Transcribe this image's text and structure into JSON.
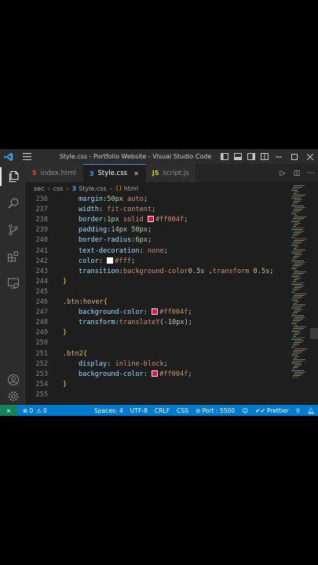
{
  "titlebar": {
    "title": "Style.css - Portfolio Website - Visual Studio Code",
    "menu_icon": "hamburger-icon",
    "logo_icon": "vscode-logo-icon"
  },
  "activitybar": [
    "explorer-icon",
    "search-icon",
    "source-control-icon",
    "extensions-icon",
    "remote-explorer-icon",
    "account-icon",
    "settings-gear-icon"
  ],
  "tabs": [
    {
      "label": "index.html",
      "icon": "5",
      "icon_color": "#e44d26",
      "active": false
    },
    {
      "label": "Style.css",
      "icon": "3",
      "icon_color": "#42a5f5",
      "active": true
    },
    {
      "label": "script.js",
      "icon": "JS",
      "icon_color": "#cbcb41",
      "active": false
    }
  ],
  "breadcrumb": {
    "parts": [
      "sec",
      "css",
      "Style.css",
      "html"
    ],
    "file_icon": "3",
    "selector_icon": "{}"
  },
  "code_lines": [
    {
      "n": "236",
      "indent": true,
      "segments": [
        [
          "prop",
          "margin"
        ],
        [
          "punc",
          ":"
        ],
        [
          "num",
          "50px"
        ],
        [
          "val",
          " auto"
        ],
        [
          "punc",
          ";"
        ]
      ]
    },
    {
      "n": "237",
      "indent": true,
      "segments": [
        [
          "prop",
          "width"
        ],
        [
          "punc",
          ": "
        ],
        [
          "val",
          "fit-content"
        ],
        [
          "punc",
          ";"
        ]
      ]
    },
    {
      "n": "238",
      "indent": true,
      "swatch": "#ff004f",
      "segments": [
        [
          "prop",
          "border"
        ],
        [
          "punc",
          ":"
        ],
        [
          "num",
          "1px"
        ],
        [
          "val",
          " solid "
        ],
        [
          "swatch",
          ""
        ],
        [
          "val",
          "#ff004f"
        ],
        [
          "punc",
          ";"
        ]
      ]
    },
    {
      "n": "239",
      "indent": true,
      "segments": [
        [
          "prop",
          "padding"
        ],
        [
          "punc",
          ":"
        ],
        [
          "num",
          "14px 50px"
        ],
        [
          "punc",
          ";"
        ]
      ]
    },
    {
      "n": "240",
      "indent": true,
      "segments": [
        [
          "prop",
          "border-radius"
        ],
        [
          "punc",
          ":"
        ],
        [
          "num",
          "6px"
        ],
        [
          "punc",
          ";"
        ]
      ]
    },
    {
      "n": "241",
      "indent": true,
      "segments": [
        [
          "prop",
          "text-decoration"
        ],
        [
          "punc",
          ": "
        ],
        [
          "val",
          "none"
        ],
        [
          "punc",
          ";"
        ]
      ]
    },
    {
      "n": "242",
      "indent": true,
      "swatch": "#ffffff",
      "segments": [
        [
          "prop",
          "color"
        ],
        [
          "punc",
          ": "
        ],
        [
          "swatch",
          ""
        ],
        [
          "val",
          "#fff"
        ],
        [
          "punc",
          ";"
        ]
      ]
    },
    {
      "n": "243",
      "indent": true,
      "segments": [
        [
          "prop",
          "transition"
        ],
        [
          "punc",
          ":"
        ],
        [
          "val",
          "background-color"
        ],
        [
          "num",
          "0.5s"
        ],
        [
          "punc",
          " ,"
        ],
        [
          "val",
          "transform "
        ],
        [
          "num",
          "0.5s"
        ],
        [
          "punc",
          ";"
        ]
      ]
    },
    {
      "n": "244",
      "indent": false,
      "segments": [
        [
          "brace",
          "}"
        ]
      ]
    },
    {
      "n": "245",
      "indent": false,
      "segments": []
    },
    {
      "n": "246",
      "indent": false,
      "segments": [
        [
          "sel",
          ".btn:hover"
        ],
        [
          "brace",
          "{"
        ]
      ]
    },
    {
      "n": "247",
      "indent": true,
      "swatch": "#ff004f",
      "segments": [
        [
          "prop",
          "background-color"
        ],
        [
          "punc",
          ": "
        ],
        [
          "swatch",
          ""
        ],
        [
          "val",
          "#ff004f"
        ],
        [
          "punc",
          ";"
        ]
      ]
    },
    {
      "n": "248",
      "indent": true,
      "segments": [
        [
          "prop",
          "transform"
        ],
        [
          "punc",
          ":"
        ],
        [
          "val",
          "translateY"
        ],
        [
          "punc",
          "("
        ],
        [
          "num",
          "-10px"
        ],
        [
          "punc",
          ");"
        ]
      ]
    },
    {
      "n": "249",
      "indent": false,
      "segments": [
        [
          "brace",
          "}"
        ]
      ]
    },
    {
      "n": "250",
      "indent": false,
      "segments": []
    },
    {
      "n": "251",
      "indent": false,
      "segments": [
        [
          "sel",
          ".btn2"
        ],
        [
          "brace",
          "{"
        ]
      ]
    },
    {
      "n": "252",
      "indent": true,
      "segments": [
        [
          "prop",
          "display"
        ],
        [
          "punc",
          ": "
        ],
        [
          "val",
          "inline-block"
        ],
        [
          "punc",
          ";"
        ]
      ]
    },
    {
      "n": "253",
      "indent": true,
      "swatch": "#ff004f",
      "segments": [
        [
          "prop",
          "background-color"
        ],
        [
          "punc",
          ": "
        ],
        [
          "swatch",
          ""
        ],
        [
          "val",
          "#ff004f"
        ],
        [
          "punc",
          ";"
        ]
      ]
    },
    {
      "n": "254",
      "indent": false,
      "segments": [
        [
          "brace",
          "}"
        ]
      ]
    },
    {
      "n": "255",
      "indent": false,
      "segments": []
    }
  ],
  "statusbar": {
    "errors": "0",
    "warnings": "0",
    "spaces": "Spaces: 4",
    "encoding": "UTF-8",
    "eol": "CRLF",
    "language": "CSS",
    "port": "Port : 5500",
    "prettier": "Prettier"
  },
  "colors": {
    "accent": "#007acc",
    "editor_bg": "#1e1e1e",
    "swatch_pink": "#ff004f"
  }
}
